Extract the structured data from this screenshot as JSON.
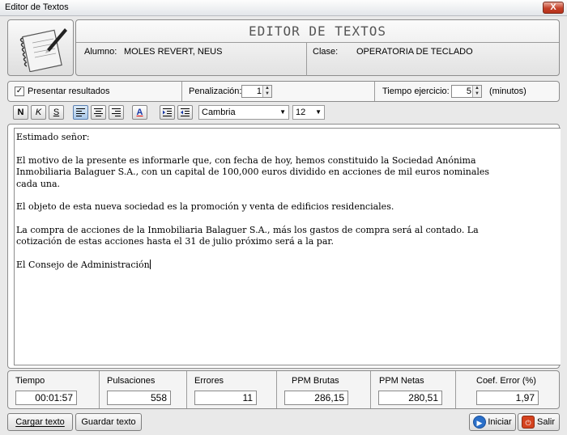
{
  "window": {
    "title": "Editor de Textos",
    "close_label": "X"
  },
  "header": {
    "title": "EDITOR DE TEXTOS",
    "alumno_label": "Alumno:",
    "alumno_value": "MOLES REVERT, NEUS",
    "clase_label": "Clase:",
    "clase_value": "OPERATORIA DE TECLADO"
  },
  "options": {
    "presentar_label": "Presentar resultados",
    "presentar_checked": "✓",
    "penalizacion_label": "Penalización:",
    "penalizacion_value": "1",
    "tiempo_label": "Tiempo ejercicio:",
    "tiempo_value": "5",
    "tiempo_unit": "(minutos)"
  },
  "toolbar": {
    "bold_label": "N",
    "italic_label": "K",
    "underline_label": "S",
    "font_color_label": "A",
    "font_name": "Cambria",
    "font_size": "12"
  },
  "editor": {
    "paragraphs": [
      "Estimado señor:",
      "El motivo de la presente es informarle que, con fecha de hoy, hemos constituido la Sociedad Anónima\nInmobiliaria Balaguer S.A., con un capital de 100,000 euros dividido en acciones de mil euros nominales\ncada una.",
      "El objeto de esta nueva sociedad es la promoción y venta de edificios residenciales.",
      "La compra de acciones de la Inmobiliaria Balaguer S.A., más los gastos de compra será al contado. La\ncotización de estas acciones hasta el 31 de julio próximo será a la par.",
      "El Consejo de Administración"
    ]
  },
  "stats": {
    "tiempo_label": "Tiempo",
    "tiempo_value": "00:01:57",
    "pulsaciones_label": "Pulsaciones",
    "pulsaciones_value": "558",
    "errores_label": "Errores",
    "errores_value": "11",
    "ppm_brutas_label": "PPM Brutas",
    "ppm_brutas_value": "286,15",
    "ppm_netas_label": "PPM Netas",
    "ppm_netas_value": "280,51",
    "coef_label": "Coef. Error (%)",
    "coef_value": "1,97"
  },
  "buttons": {
    "cargar": "Cargar texto",
    "guardar": "Guardar texto",
    "iniciar": "Iniciar",
    "salir": "Salir"
  },
  "colors": {
    "accent_blue": "#2a6fc9",
    "exit_red": "#d4421e",
    "close_red": "#c4412a"
  }
}
